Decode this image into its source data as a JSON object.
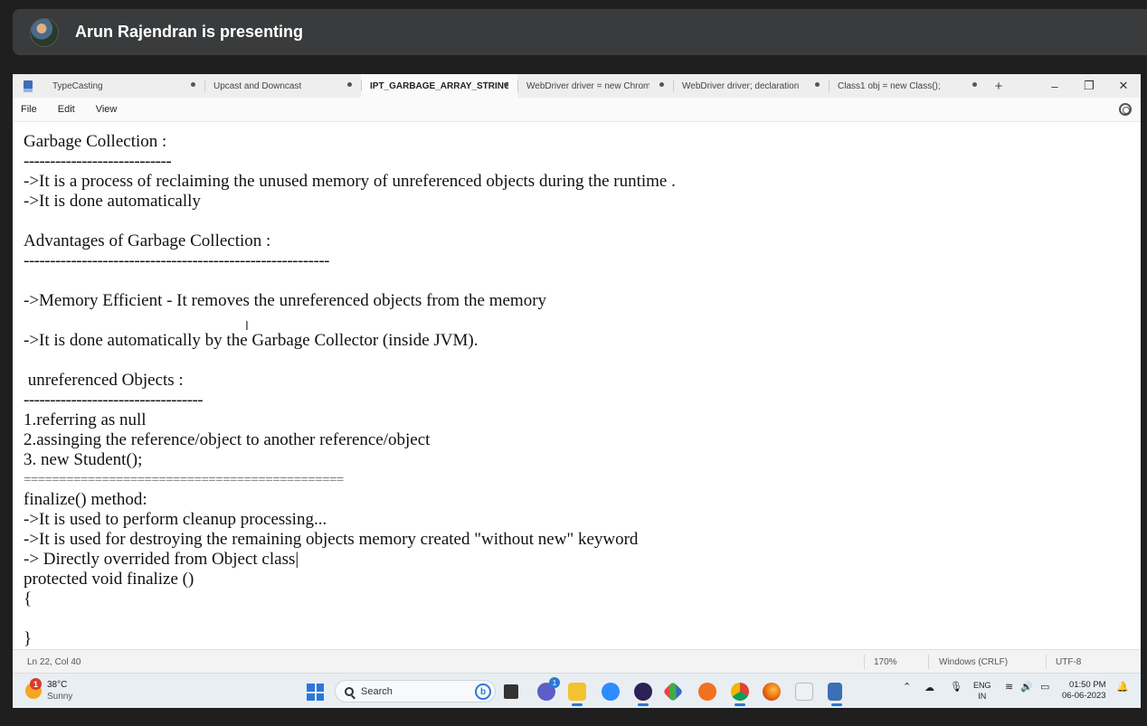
{
  "presenter": {
    "text": "Arun Rajendran is presenting"
  },
  "tabs": [
    {
      "label": "TypeCasting",
      "active": false
    },
    {
      "label": "Upcast and Downcast",
      "active": false
    },
    {
      "label": "IPT_GARBAGE_ARRAY_STRING",
      "active": true
    },
    {
      "label": "WebDriver driver = new Chrom",
      "active": false
    },
    {
      "label": "WebDriver driver;  declaration",
      "active": false
    },
    {
      "label": "Class1 obj = new Class();",
      "active": false
    }
  ],
  "window": {
    "new_tab": "+",
    "minimize": "–",
    "restore": "❐",
    "close": "✕"
  },
  "menu": {
    "file": "File",
    "edit": "Edit",
    "view": "View"
  },
  "editor": {
    "lines": [
      "Garbage Collection :",
      "----------------------------",
      "->It is a process of reclaiming the unused memory of unreferenced objects during the runtime .",
      "->It is done automatically",
      "",
      "Advantages of Garbage Collection :",
      "----------------------------------------------------------",
      "",
      "->Memory Efficient - It removes the unreferenced objects from the memory",
      "",
      "->It is done automatically by the Garbage Collector (inside JVM).",
      "",
      " unreferenced Objects :",
      "----------------------------------",
      "1.referring as null",
      "2.assinging the reference/object to another reference/object",
      "3. new Student();",
      "=============================================",
      "finalize() method:",
      "->It is used to perform cleanup processing...",
      "->It is used for destroying the remaining objects memory created \"without new\" keyword",
      "-> Directly overrided from Object class|",
      "protected void finalize ()",
      "{",
      "",
      "}"
    ],
    "cursor_glyph": "I"
  },
  "status": {
    "position": "Ln 22, Col 40",
    "zoom": "170%",
    "line_ending": "Windows (CRLF)",
    "encoding": "UTF-8"
  },
  "taskbar": {
    "weather_badge": "1",
    "temperature": "38°C",
    "condition": "Sunny",
    "search_placeholder": "Search",
    "bing_label": "b",
    "teams_badge": "1",
    "lang_top": "ENG",
    "lang_bottom": "IN",
    "time": "01:50 PM",
    "date": "06-06-2023"
  }
}
